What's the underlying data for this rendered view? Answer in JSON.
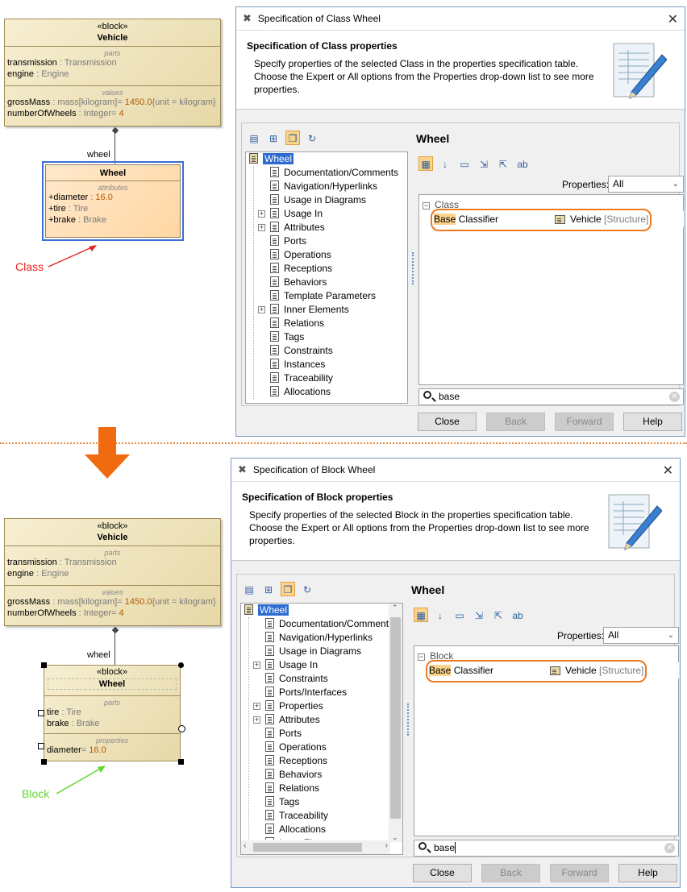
{
  "top": {
    "vehicle": {
      "stereotype": "«block»",
      "name": "Vehicle",
      "parts_title": "parts",
      "parts": [
        {
          "name": "transmission",
          "type": " : Transmission"
        },
        {
          "name": "engine",
          "type": " : Engine"
        }
      ],
      "values_title": "values",
      "values": [
        {
          "name": "grossMass",
          "type": " : mass[kilogram]= ",
          "value": "1450.0",
          "extra": "{unit = kilogram}"
        },
        {
          "name": "numberOfWheels",
          "type": " : Integer= ",
          "value": "4",
          "extra": ""
        }
      ]
    },
    "role_label": "wheel",
    "wheel": {
      "name": "Wheel",
      "attributes_title": "attributes",
      "attributes": [
        {
          "name": "+diameter",
          "type": " : ",
          "value": "16.0"
        },
        {
          "name": "+tire",
          "type": " : Tire",
          "value": ""
        },
        {
          "name": "+brake",
          "type": " : Brake",
          "value": ""
        }
      ]
    },
    "annotation": "Class",
    "annotation_color": "#e8231f",
    "dialog": {
      "title": "Specification of Class Wheel",
      "header_title": "Specification of Class properties",
      "header_desc": "Specify properties of the selected Class in the properties specification table. Choose the Expert or All options from the Properties drop-down list to see more properties.",
      "tree_root": "Wheel",
      "tree_items": [
        "Documentation/Comments",
        "Navigation/Hyperlinks",
        "Usage in Diagrams",
        "Usage In",
        "Attributes",
        "Ports",
        "Operations",
        "Receptions",
        "Behaviors",
        "Template Parameters",
        "Inner Elements",
        "Relations",
        "Tags",
        "Constraints",
        "Instances",
        "Traceability",
        "Allocations"
      ],
      "panel_title": "Wheel",
      "properties_label": "Properties:",
      "properties_value": "All",
      "group": "Class",
      "prop_hl": "Base",
      "prop_rest": " Classifier",
      "prop_value": "Vehicle",
      "prop_value_extra": " [Structure]",
      "search": "base",
      "buttons": {
        "close": "Close",
        "back": "Back",
        "forward": "Forward",
        "help": "Help"
      }
    }
  },
  "bottom": {
    "vehicle": {
      "stereotype": "«block»",
      "name": "Vehicle",
      "parts_title": "parts",
      "parts": [
        {
          "name": "transmission",
          "type": " : Transmission"
        },
        {
          "name": "engine",
          "type": " : Engine"
        }
      ],
      "values_title": "values",
      "values": [
        {
          "name": "grossMass",
          "type": " : mass[kilogram]= ",
          "value": "1450.0",
          "extra": "{unit = kilogram}"
        },
        {
          "name": "numberOfWheels",
          "type": " : Integer= ",
          "value": "4",
          "extra": ""
        }
      ]
    },
    "role_label": "wheel",
    "wheel": {
      "stereotype": "«block»",
      "name": "Wheel",
      "parts_title": "parts",
      "parts": [
        {
          "name": "tire",
          "type": " : Tire"
        },
        {
          "name": "brake",
          "type": " : Brake"
        }
      ],
      "properties_title": "properties",
      "properties": [
        {
          "name": "diameter",
          "type": "= ",
          "value": "16.0"
        }
      ]
    },
    "annotation": "Block",
    "annotation_color": "#5fd82e",
    "dialog": {
      "title": "Specification of Block Wheel",
      "header_title": "Specification of Block properties",
      "header_desc": "Specify properties of the selected Block in the properties specification table. Choose the Expert or All options from the Properties drop-down list to see more properties.",
      "tree_root": "Wheel",
      "tree_items": [
        "Documentation/Comment",
        "Navigation/Hyperlinks",
        "Usage in Diagrams",
        "Usage In",
        "Constraints",
        "Ports/Interfaces",
        "Properties",
        "Attributes",
        "Ports",
        "Operations",
        "Receptions",
        "Behaviors",
        "Relations",
        "Tags",
        "Traceability",
        "Allocations",
        "Inner Elements"
      ],
      "panel_title": "Wheel",
      "properties_label": "Properties:",
      "properties_value": "All",
      "group": "Block",
      "prop_hl": "Base",
      "prop_rest": " Classifier",
      "prop_value": "Vehicle",
      "prop_value_extra": " [Structure]",
      "search": "base",
      "buttons": {
        "close": "Close",
        "back": "Back",
        "forward": "Forward",
        "help": "Help"
      }
    }
  },
  "arrow_color": "#f06a10",
  "highlight_color": "#ee7a20"
}
